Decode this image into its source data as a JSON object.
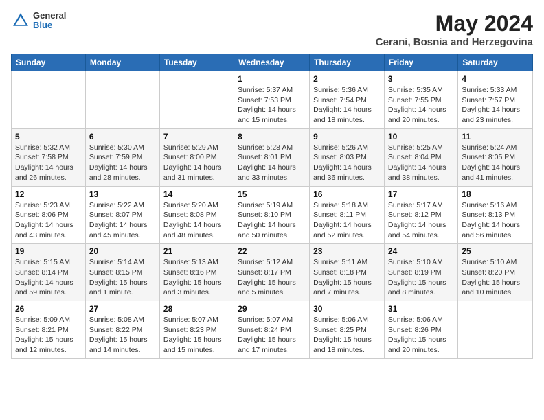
{
  "logo": {
    "general": "General",
    "blue": "Blue"
  },
  "title": "May 2024",
  "location": "Cerani, Bosnia and Herzegovina",
  "headers": [
    "Sunday",
    "Monday",
    "Tuesday",
    "Wednesday",
    "Thursday",
    "Friday",
    "Saturday"
  ],
  "weeks": [
    [
      {
        "day": "",
        "info": ""
      },
      {
        "day": "",
        "info": ""
      },
      {
        "day": "",
        "info": ""
      },
      {
        "day": "1",
        "info": "Sunrise: 5:37 AM\nSunset: 7:53 PM\nDaylight: 14 hours\nand 15 minutes."
      },
      {
        "day": "2",
        "info": "Sunrise: 5:36 AM\nSunset: 7:54 PM\nDaylight: 14 hours\nand 18 minutes."
      },
      {
        "day": "3",
        "info": "Sunrise: 5:35 AM\nSunset: 7:55 PM\nDaylight: 14 hours\nand 20 minutes."
      },
      {
        "day": "4",
        "info": "Sunrise: 5:33 AM\nSunset: 7:57 PM\nDaylight: 14 hours\nand 23 minutes."
      }
    ],
    [
      {
        "day": "5",
        "info": "Sunrise: 5:32 AM\nSunset: 7:58 PM\nDaylight: 14 hours\nand 26 minutes."
      },
      {
        "day": "6",
        "info": "Sunrise: 5:30 AM\nSunset: 7:59 PM\nDaylight: 14 hours\nand 28 minutes."
      },
      {
        "day": "7",
        "info": "Sunrise: 5:29 AM\nSunset: 8:00 PM\nDaylight: 14 hours\nand 31 minutes."
      },
      {
        "day": "8",
        "info": "Sunrise: 5:28 AM\nSunset: 8:01 PM\nDaylight: 14 hours\nand 33 minutes."
      },
      {
        "day": "9",
        "info": "Sunrise: 5:26 AM\nSunset: 8:03 PM\nDaylight: 14 hours\nand 36 minutes."
      },
      {
        "day": "10",
        "info": "Sunrise: 5:25 AM\nSunset: 8:04 PM\nDaylight: 14 hours\nand 38 minutes."
      },
      {
        "day": "11",
        "info": "Sunrise: 5:24 AM\nSunset: 8:05 PM\nDaylight: 14 hours\nand 41 minutes."
      }
    ],
    [
      {
        "day": "12",
        "info": "Sunrise: 5:23 AM\nSunset: 8:06 PM\nDaylight: 14 hours\nand 43 minutes."
      },
      {
        "day": "13",
        "info": "Sunrise: 5:22 AM\nSunset: 8:07 PM\nDaylight: 14 hours\nand 45 minutes."
      },
      {
        "day": "14",
        "info": "Sunrise: 5:20 AM\nSunset: 8:08 PM\nDaylight: 14 hours\nand 48 minutes."
      },
      {
        "day": "15",
        "info": "Sunrise: 5:19 AM\nSunset: 8:10 PM\nDaylight: 14 hours\nand 50 minutes."
      },
      {
        "day": "16",
        "info": "Sunrise: 5:18 AM\nSunset: 8:11 PM\nDaylight: 14 hours\nand 52 minutes."
      },
      {
        "day": "17",
        "info": "Sunrise: 5:17 AM\nSunset: 8:12 PM\nDaylight: 14 hours\nand 54 minutes."
      },
      {
        "day": "18",
        "info": "Sunrise: 5:16 AM\nSunset: 8:13 PM\nDaylight: 14 hours\nand 56 minutes."
      }
    ],
    [
      {
        "day": "19",
        "info": "Sunrise: 5:15 AM\nSunset: 8:14 PM\nDaylight: 14 hours\nand 59 minutes."
      },
      {
        "day": "20",
        "info": "Sunrise: 5:14 AM\nSunset: 8:15 PM\nDaylight: 15 hours\nand 1 minute."
      },
      {
        "day": "21",
        "info": "Sunrise: 5:13 AM\nSunset: 8:16 PM\nDaylight: 15 hours\nand 3 minutes."
      },
      {
        "day": "22",
        "info": "Sunrise: 5:12 AM\nSunset: 8:17 PM\nDaylight: 15 hours\nand 5 minutes."
      },
      {
        "day": "23",
        "info": "Sunrise: 5:11 AM\nSunset: 8:18 PM\nDaylight: 15 hours\nand 7 minutes."
      },
      {
        "day": "24",
        "info": "Sunrise: 5:10 AM\nSunset: 8:19 PM\nDaylight: 15 hours\nand 8 minutes."
      },
      {
        "day": "25",
        "info": "Sunrise: 5:10 AM\nSunset: 8:20 PM\nDaylight: 15 hours\nand 10 minutes."
      }
    ],
    [
      {
        "day": "26",
        "info": "Sunrise: 5:09 AM\nSunset: 8:21 PM\nDaylight: 15 hours\nand 12 minutes."
      },
      {
        "day": "27",
        "info": "Sunrise: 5:08 AM\nSunset: 8:22 PM\nDaylight: 15 hours\nand 14 minutes."
      },
      {
        "day": "28",
        "info": "Sunrise: 5:07 AM\nSunset: 8:23 PM\nDaylight: 15 hours\nand 15 minutes."
      },
      {
        "day": "29",
        "info": "Sunrise: 5:07 AM\nSunset: 8:24 PM\nDaylight: 15 hours\nand 17 minutes."
      },
      {
        "day": "30",
        "info": "Sunrise: 5:06 AM\nSunset: 8:25 PM\nDaylight: 15 hours\nand 18 minutes."
      },
      {
        "day": "31",
        "info": "Sunrise: 5:06 AM\nSunset: 8:26 PM\nDaylight: 15 hours\nand 20 minutes."
      },
      {
        "day": "",
        "info": ""
      }
    ]
  ]
}
